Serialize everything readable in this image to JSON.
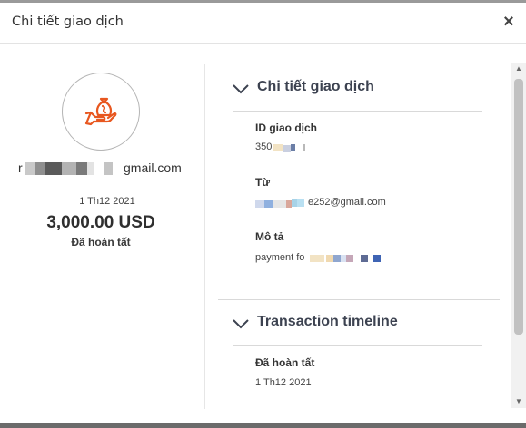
{
  "dialog": {
    "title": "Chi tiết giao dịch",
    "close_icon": "×"
  },
  "summary": {
    "icon": "money-bag-hand-icon",
    "email_prefix": "r",
    "email_suffix": "gmail.com",
    "date": "1 Th12 2021",
    "amount": "3,000.00 USD",
    "status": "Đã hoàn tất",
    "accent_color": "#e8571f"
  },
  "details": {
    "section_title": "Chi tiết giao dịch",
    "id_label": "ID giao dịch",
    "id_value": "350",
    "from_label": "Từ",
    "from_value": "e252@gmail.com",
    "desc_label": "Mô tả",
    "desc_value": "payment fo"
  },
  "timeline": {
    "section_title": "Transaction timeline",
    "status": "Đã hoàn tất",
    "date": "1 Th12 2021"
  }
}
